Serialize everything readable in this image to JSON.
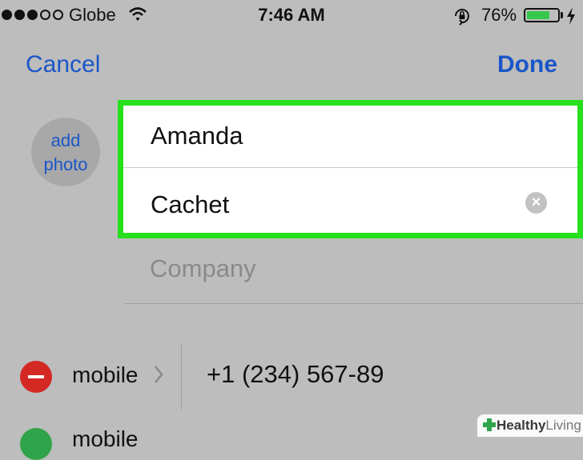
{
  "status_bar": {
    "carrier": "Globe",
    "time": "7:46 AM",
    "battery_percent_text": "76%",
    "battery_level": 0.76,
    "signal_bars": 3,
    "signal_total": 5,
    "icons": [
      "signal-dots-icon",
      "wifi-icon",
      "rotation-lock-icon",
      "battery-icon",
      "charging-bolt-icon"
    ]
  },
  "nav": {
    "cancel_label": "Cancel",
    "done_label": "Done"
  },
  "photo": {
    "label_line1": "add",
    "label_line2": "photo"
  },
  "name_fields": {
    "first_name": "Amanda",
    "last_name": "Cachet"
  },
  "company": {
    "placeholder": "Company"
  },
  "phone": {
    "label": "mobile",
    "number": "+1 (234) 567-89"
  },
  "add_phone": {
    "label": "mobile"
  },
  "watermark": {
    "brand_bold": "Healthy",
    "brand_light": "Living"
  },
  "colors": {
    "accent": "#1a56c8",
    "highlight": "#27e01c",
    "remove": "#d42824",
    "add": "#2fa44b",
    "battery": "#36c84a"
  }
}
